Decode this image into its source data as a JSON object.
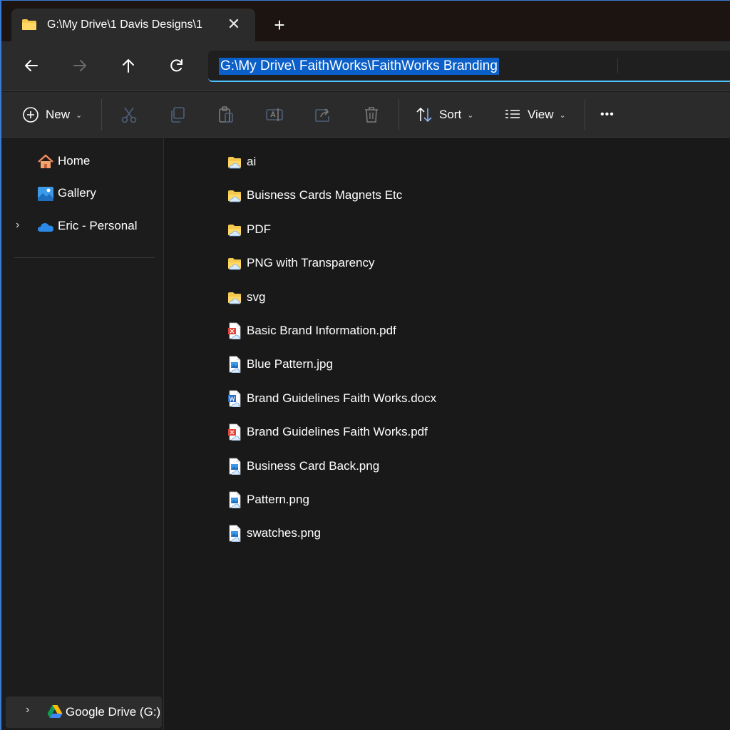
{
  "tab": {
    "title": "G:\\My Drive\\1 Davis Designs\\1",
    "close_label": "✕",
    "new_tab_label": "+"
  },
  "nav": {
    "back": "back-arrow-icon",
    "forward": "forward-arrow-icon",
    "up": "up-arrow-icon",
    "refresh": "refresh-icon",
    "address_value": "G:\\My Drive\\ FaithWorks\\FaithWorks Branding"
  },
  "toolbar": {
    "new_label": "New",
    "sort_label": "Sort",
    "view_label": "View",
    "more_label": "•••",
    "icons": [
      "cut-icon",
      "copy-icon",
      "paste-icon",
      "rename-icon",
      "share-icon",
      "delete-icon"
    ]
  },
  "sidebar": {
    "items": [
      {
        "label": "Home",
        "icon": "home-icon"
      },
      {
        "label": "Gallery",
        "icon": "gallery-icon"
      },
      {
        "label": "Eric - Personal",
        "icon": "onedrive-cloud-icon"
      }
    ],
    "drive": {
      "label": "Google Drive (G:)",
      "icon": "google-drive-icon"
    }
  },
  "files": [
    {
      "name": "ai",
      "type": "folder"
    },
    {
      "name": "Buisness Cards Magnets Etc",
      "type": "folder"
    },
    {
      "name": "PDF",
      "type": "folder"
    },
    {
      "name": "PNG with Transparency",
      "type": "folder"
    },
    {
      "name": "svg",
      "type": "folder"
    },
    {
      "name": "Basic Brand Information.pdf",
      "type": "pdf"
    },
    {
      "name": "Blue Pattern.jpg",
      "type": "image"
    },
    {
      "name": "Brand Guidelines Faith Works.docx",
      "type": "docx"
    },
    {
      "name": "Brand Guidelines Faith Works.pdf",
      "type": "pdf"
    },
    {
      "name": "Business Card Back.png",
      "type": "image"
    },
    {
      "name": "Pattern.png",
      "type": "image"
    },
    {
      "name": "swatches.png",
      "type": "image"
    }
  ],
  "colors": {
    "accent": "#4cc2ff",
    "selection": "#0a5fc8",
    "folder": "#f5c94c",
    "background": "#191919"
  }
}
